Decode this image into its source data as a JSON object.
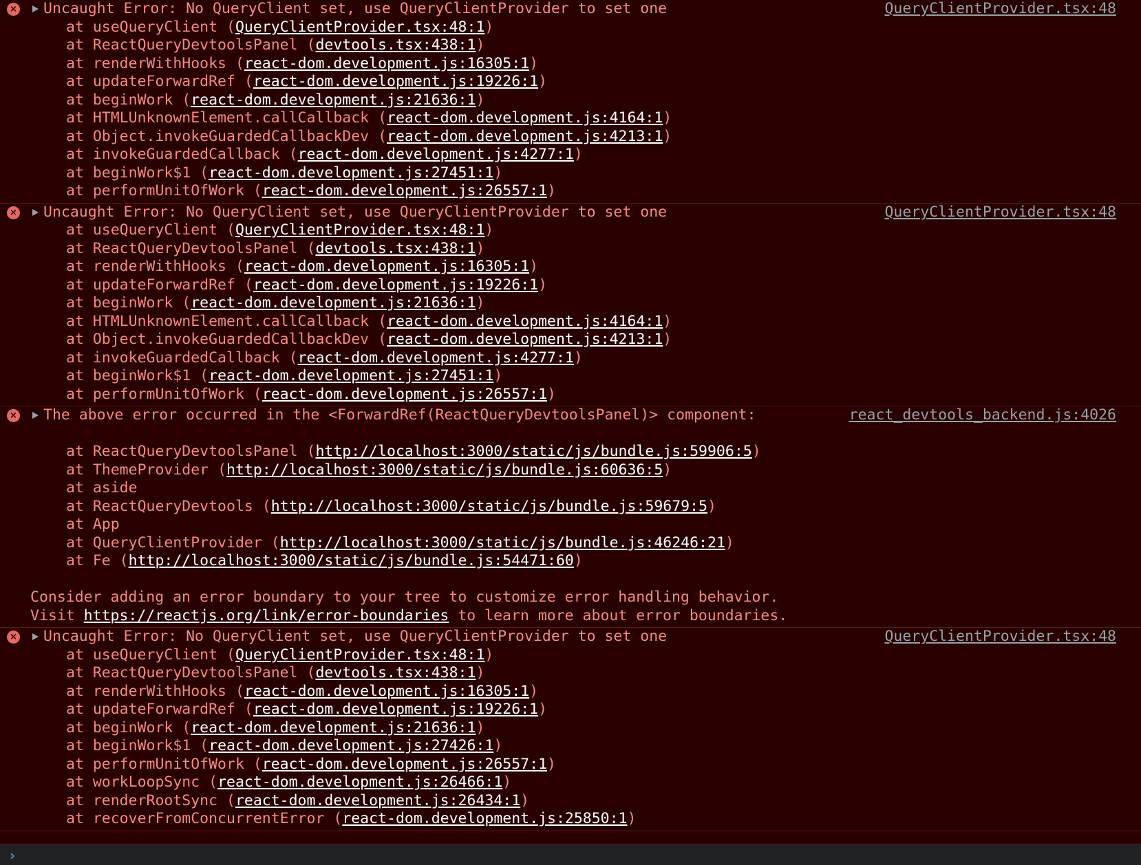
{
  "colors": {
    "background": "#280000",
    "error_text": "#f28b82",
    "link_text": "#ffffff",
    "source_link": "#9aa0a6",
    "divider": "#5c1a1a",
    "error_icon": "#e46962",
    "prompt_bg": "#202124",
    "prompt_chevron": "#4f8bd6"
  },
  "icons": {
    "error": "×",
    "expand": "triangle-right",
    "prompt": "›"
  },
  "messages": [
    {
      "type": "error",
      "text": "Uncaught Error: No QueryClient set, use QueryClientProvider to set one",
      "source": "QueryClientProvider.tsx:48",
      "frames": [
        {
          "fn": "useQueryClient",
          "loc": "QueryClientProvider.tsx:48:1"
        },
        {
          "fn": "ReactQueryDevtoolsPanel",
          "loc": "devtools.tsx:438:1"
        },
        {
          "fn": "renderWithHooks",
          "loc": "react-dom.development.js:16305:1"
        },
        {
          "fn": "updateForwardRef",
          "loc": "react-dom.development.js:19226:1"
        },
        {
          "fn": "beginWork",
          "loc": "react-dom.development.js:21636:1"
        },
        {
          "fn": "HTMLUnknownElement.callCallback",
          "loc": "react-dom.development.js:4164:1"
        },
        {
          "fn": "Object.invokeGuardedCallbackDev",
          "loc": "react-dom.development.js:4213:1"
        },
        {
          "fn": "invokeGuardedCallback",
          "loc": "react-dom.development.js:4277:1"
        },
        {
          "fn": "beginWork$1",
          "loc": "react-dom.development.js:27451:1"
        },
        {
          "fn": "performUnitOfWork",
          "loc": "react-dom.development.js:26557:1"
        }
      ]
    },
    {
      "type": "error",
      "text": "Uncaught Error: No QueryClient set, use QueryClientProvider to set one",
      "source": "QueryClientProvider.tsx:48",
      "frames": [
        {
          "fn": "useQueryClient",
          "loc": "QueryClientProvider.tsx:48:1"
        },
        {
          "fn": "ReactQueryDevtoolsPanel",
          "loc": "devtools.tsx:438:1"
        },
        {
          "fn": "renderWithHooks",
          "loc": "react-dom.development.js:16305:1"
        },
        {
          "fn": "updateForwardRef",
          "loc": "react-dom.development.js:19226:1"
        },
        {
          "fn": "beginWork",
          "loc": "react-dom.development.js:21636:1"
        },
        {
          "fn": "HTMLUnknownElement.callCallback",
          "loc": "react-dom.development.js:4164:1"
        },
        {
          "fn": "Object.invokeGuardedCallbackDev",
          "loc": "react-dom.development.js:4213:1"
        },
        {
          "fn": "invokeGuardedCallback",
          "loc": "react-dom.development.js:4277:1"
        },
        {
          "fn": "beginWork$1",
          "loc": "react-dom.development.js:27451:1"
        },
        {
          "fn": "performUnitOfWork",
          "loc": "react-dom.development.js:26557:1"
        }
      ]
    },
    {
      "type": "error",
      "text": "The above error occurred in the <ForwardRef(ReactQueryDevtoolsPanel)> component:",
      "source": "react_devtools_backend.js:4026",
      "leading_blank": true,
      "frames": [
        {
          "fn": "ReactQueryDevtoolsPanel",
          "loc": "http://localhost:3000/static/js/bundle.js:59906:5"
        },
        {
          "fn": "ThemeProvider",
          "loc": "http://localhost:3000/static/js/bundle.js:60636:5"
        },
        {
          "fn": "aside",
          "loc": null
        },
        {
          "fn": "ReactQueryDevtools",
          "loc": "http://localhost:3000/static/js/bundle.js:59679:5"
        },
        {
          "fn": "App",
          "loc": null
        },
        {
          "fn": "QueryClientProvider",
          "loc": "http://localhost:3000/static/js/bundle.js:46246:21"
        },
        {
          "fn": "Fe",
          "loc": "http://localhost:3000/static/js/bundle.js:54471:60"
        }
      ],
      "notes": [
        {
          "before": "Consider adding an error boundary to your tree to customize error handling behavior.",
          "link": null,
          "after": ""
        },
        {
          "before": "Visit ",
          "link": "https://reactjs.org/link/error-boundaries",
          "after": " to learn more about error boundaries."
        }
      ]
    },
    {
      "type": "error",
      "text": "Uncaught Error: No QueryClient set, use QueryClientProvider to set one",
      "source": "QueryClientProvider.tsx:48",
      "frames": [
        {
          "fn": "useQueryClient",
          "loc": "QueryClientProvider.tsx:48:1"
        },
        {
          "fn": "ReactQueryDevtoolsPanel",
          "loc": "devtools.tsx:438:1"
        },
        {
          "fn": "renderWithHooks",
          "loc": "react-dom.development.js:16305:1"
        },
        {
          "fn": "updateForwardRef",
          "loc": "react-dom.development.js:19226:1"
        },
        {
          "fn": "beginWork",
          "loc": "react-dom.development.js:21636:1"
        },
        {
          "fn": "beginWork$1",
          "loc": "react-dom.development.js:27426:1"
        },
        {
          "fn": "performUnitOfWork",
          "loc": "react-dom.development.js:26557:1"
        },
        {
          "fn": "workLoopSync",
          "loc": "react-dom.development.js:26466:1"
        },
        {
          "fn": "renderRootSync",
          "loc": "react-dom.development.js:26434:1"
        },
        {
          "fn": "recoverFromConcurrentError",
          "loc": "react-dom.development.js:25850:1"
        }
      ]
    }
  ],
  "frame_prefix": "at ",
  "prompt": {
    "value": "",
    "placeholder": ""
  }
}
